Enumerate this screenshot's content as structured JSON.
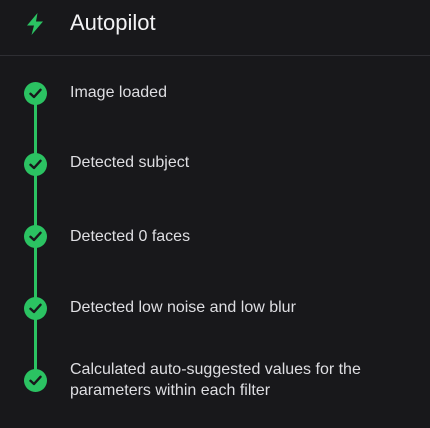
{
  "header": {
    "title": "Autopilot",
    "icon": "lightning-bolt-icon",
    "accent_color": "#2bc262"
  },
  "steps": [
    {
      "label": "Image loaded",
      "status": "done",
      "icon": "check-icon"
    },
    {
      "label": "Detected subject",
      "status": "done",
      "icon": "check-icon"
    },
    {
      "label": "Detected 0 faces",
      "status": "done",
      "icon": "check-icon"
    },
    {
      "label": "Detected low noise and low blur",
      "status": "done",
      "icon": "check-icon"
    },
    {
      "label": "Calculated auto-suggested values for the parameters within each filter",
      "status": "done",
      "icon": "check-icon"
    }
  ]
}
